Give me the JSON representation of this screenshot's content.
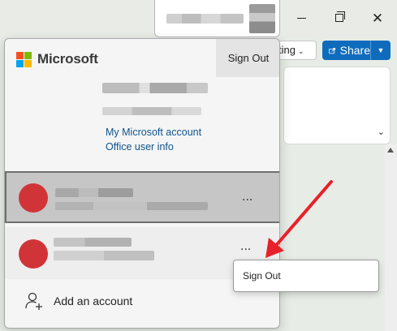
{
  "window_controls": {
    "minimize_icon": "minimize-icon",
    "maximize_icon": "restore-icon",
    "close_icon": "close-icon",
    "close_glyph": "✕"
  },
  "toolbar": {
    "editing_label": "Editing",
    "editing_visible_text": "ting",
    "share_label": "Share",
    "share_color": "#0f6cbd"
  },
  "account_flyout": {
    "brand": "Microsoft",
    "brand_colors": [
      "#f25022",
      "#7fba00",
      "#00a4ef",
      "#ffb900"
    ],
    "sign_out_label": "Sign Out",
    "links": {
      "my_account": "My Microsoft account",
      "office_info": "Office user info"
    },
    "accounts": [
      {
        "avatar_color": "#d13438",
        "active": true,
        "more_label": "..."
      },
      {
        "avatar_color": "#d13438",
        "active": false,
        "more_label": "..."
      }
    ],
    "add_account_label": "Add an account"
  },
  "context_menu": {
    "items": [
      "Sign Out"
    ]
  },
  "annotation": {
    "arrow_color": "#e8202a"
  }
}
